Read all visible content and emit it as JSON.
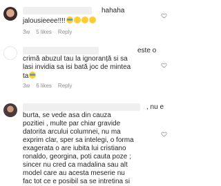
{
  "comments": [
    {
      "text_lines": [
        "hahaha",
        "jalousieeee!!!!"
      ],
      "emojis": [
        "sad-crying-emoji",
        "smile-emoji",
        "smile-emoji",
        "smile-emoji"
      ],
      "time": "3w",
      "likes": "5 likes",
      "reply": "Reply"
    },
    {
      "text_lines": [
        "este o",
        "crimă abuzul tau la ignoranță si sa",
        "lasi invidia sa isi bată joc de mintea",
        "ta"
      ],
      "emojis": [
        "sad-emoji"
      ],
      "time": "3w",
      "likes": "6 likes",
      "reply": "Reply"
    },
    {
      "text_lines": [
        ", nu e",
        "burta, se  vede asa din cauza",
        "pozitiei , multe par chiar gravide",
        "datorita arcului columnei, nu ma",
        "exprim clar, sper sa intelegi, o forma",
        "exagerata o are iubita lui cristiano",
        "ronaldo, georgina, poti cauta poze ;",
        "sincer nu cred ca madalina sau alt",
        "model care au acesta meserie nu",
        "fac tot ce e posibil sa se intretina si"
      ]
    }
  ]
}
